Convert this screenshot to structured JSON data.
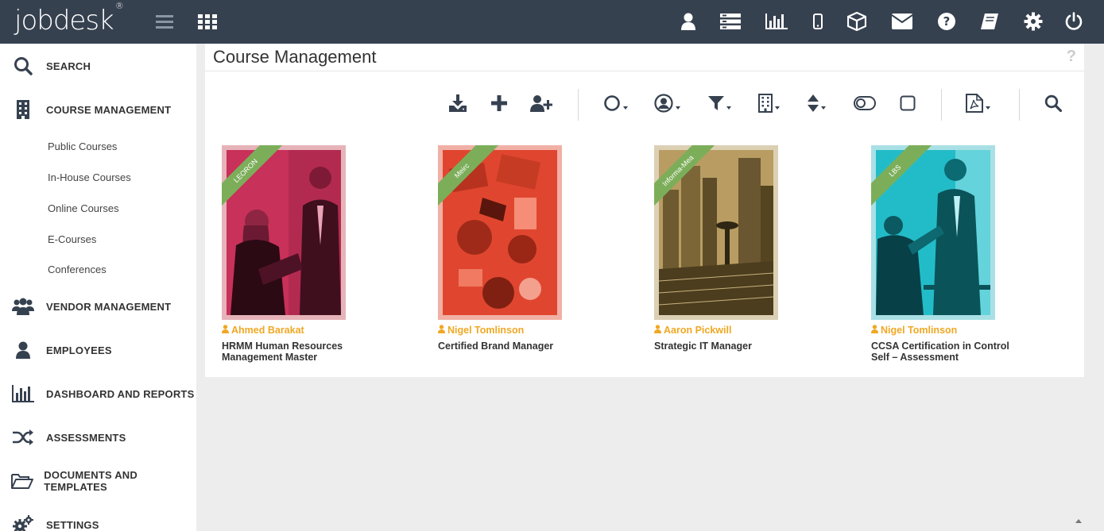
{
  "app": {
    "logo": "jobdesk",
    "logo_mark": "®"
  },
  "topbar": {
    "icons": [
      "menu-icon",
      "apps-grid-icon",
      "user-icon",
      "server-icon",
      "bar-chart-icon",
      "mobile-icon",
      "cube-icon",
      "envelope-icon",
      "question-icon",
      "book-icon",
      "gear-icon",
      "power-icon"
    ]
  },
  "sidebar": {
    "search": "SEARCH",
    "course_management": "COURSE MANAGEMENT",
    "sub": [
      "Public Courses",
      "In-House Courses",
      "Online Courses",
      "E-Courses",
      "Conferences"
    ],
    "vendor_management": "VENDOR MANAGEMENT",
    "employees": "EMPLOYEES",
    "dashboard": "DASHBOARD AND REPORTS",
    "assessments": "ASSESSMENTS",
    "documents": "DOCUMENTS AND TEMPLATES",
    "settings": "SETTINGS"
  },
  "main": {
    "title": "Course Management",
    "help": "?",
    "toolbar_icons": [
      "download-icon",
      "add-icon",
      "add-user-icon",
      "status-circle-icon",
      "user-circle-icon",
      "filter-icon",
      "building-icon",
      "sort-icon",
      "toggle-icon",
      "checkbox-icon",
      "pdf-icon",
      "search-icon"
    ]
  },
  "courses": [
    {
      "vendor": "LEORON",
      "instructor": "Ahmed Barakat",
      "title": "HRMM Human Resources Management Master",
      "tint": "#c8315a"
    },
    {
      "vendor": "Meirc",
      "instructor": "Nigel Tomlinson",
      "title": "Certified Brand Manager",
      "tint": "#e0462f"
    },
    {
      "vendor": "Informa-Mea",
      "instructor": "Aaron Pickwill",
      "title": "Strategic IT Manager",
      "tint": "#a68a4e"
    },
    {
      "vendor": "LBS",
      "instructor": "Nigel Tomlinson",
      "title": "CCSA Certification in Control Self – Assessment",
      "tint": "#18b3c0"
    }
  ],
  "colors": {
    "topbar": "#364150",
    "accent_orange": "#f0a824",
    "ribbon_green": "#7cae5a"
  }
}
